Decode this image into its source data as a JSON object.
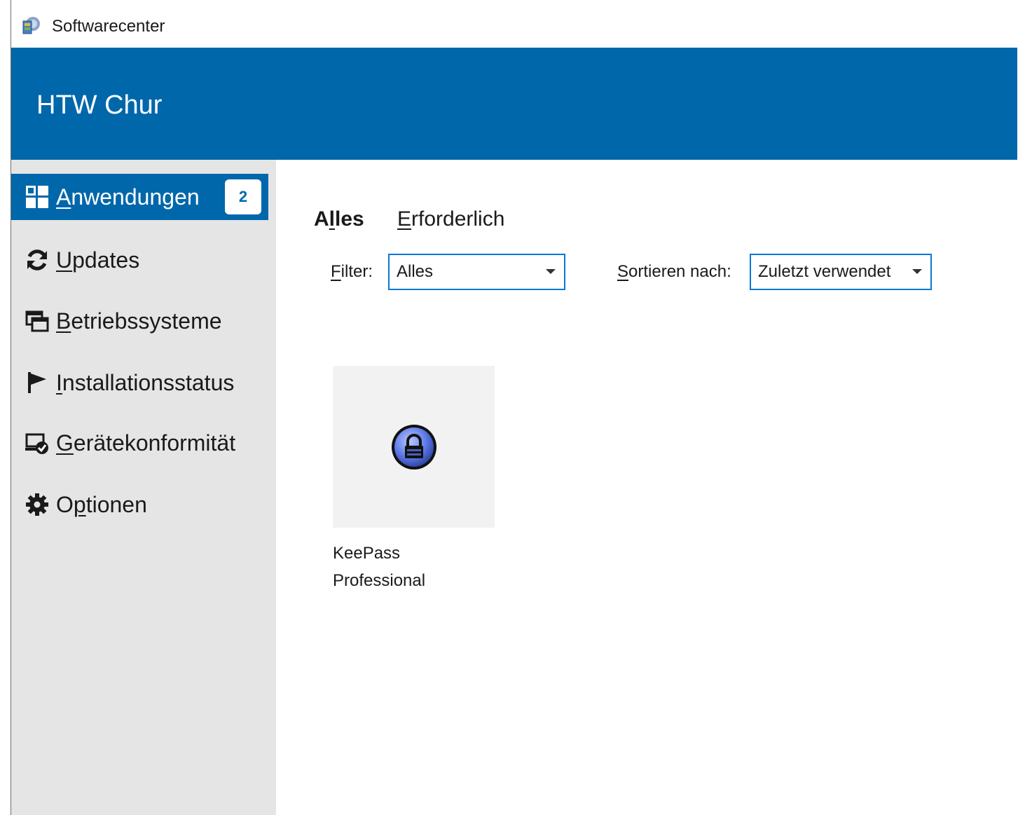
{
  "window": {
    "title": "Softwarecenter",
    "icon": "softwarecenter-app-icon"
  },
  "header": {
    "org_name": "HTW Chur",
    "background": "#0067ab"
  },
  "sidebar": {
    "items": [
      {
        "pre": "",
        "u": "A",
        "post": "nwendungen",
        "icon": "applications-grid-icon",
        "active": true,
        "badge": "2"
      },
      {
        "pre": "",
        "u": "U",
        "post": "pdates",
        "icon": "refresh-icon",
        "active": false
      },
      {
        "pre": "",
        "u": "B",
        "post": "etriebssysteme",
        "icon": "windows-stack-icon",
        "active": false
      },
      {
        "pre": "",
        "u": "I",
        "post": "nstallationsstatus",
        "icon": "flag-icon",
        "active": false
      },
      {
        "pre": "",
        "u": "G",
        "post": "erätekonformität",
        "icon": "device-compliance-icon",
        "active": false
      },
      {
        "pre": "O",
        "u": "p",
        "post": "tionen",
        "icon": "gear-icon",
        "active": false
      }
    ]
  },
  "tabs": [
    {
      "pre": "A",
      "u": "l",
      "post": "les",
      "active": true
    },
    {
      "pre": "",
      "u": "E",
      "post": "rforderlich",
      "active": false
    }
  ],
  "filter": {
    "label_u": "F",
    "label_post": "ilter:",
    "value": "Alles"
  },
  "sort": {
    "label_u": "S",
    "label_post": "ortieren nach:",
    "value": "Zuletzt verwendet"
  },
  "apps": [
    {
      "line1": "KeePass",
      "line2": "Professional",
      "icon": "keepass-lock-icon"
    }
  ]
}
